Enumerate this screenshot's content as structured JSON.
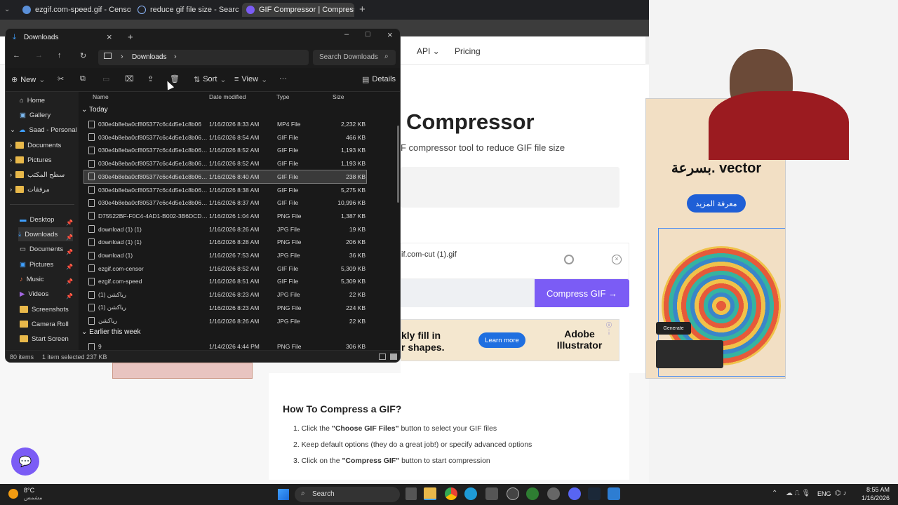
{
  "browser": {
    "tabs": [
      {
        "title": "ezgif.com-speed.gif - Censor a GI",
        "icon": "ezgif-icon"
      },
      {
        "title": "reduce gif file size - Search",
        "icon": "search-icon"
      },
      {
        "title": "GIF Compressor | Compress GIF A",
        "icon": "compressor-icon"
      }
    ],
    "new_tab": "+"
  },
  "site": {
    "nav": {
      "api": "API ⌄",
      "pricing": "Pricing"
    },
    "hero_title": "Compressor",
    "hero_subtitle": "F compressor tool to reduce GIF file size",
    "file_name": "if.com-cut (1).gif",
    "compress_button": "Compress GIF →",
    "ad": {
      "text_line1": "kly fill in",
      "text_line2": "r shapes.",
      "cta": "Learn more",
      "brand_line1": "Adobe",
      "brand_line2": "Illustrator"
    },
    "howto": {
      "title": "How To Compress a GIF?",
      "steps": [
        {
          "pre": "1. Click the ",
          "bold": "\"Choose GIF Files\"",
          "post": " button to select your GIF files"
        },
        {
          "pre": "2. Keep default options (they do a great job!) or specify advanced options",
          "bold": "",
          "post": ""
        },
        {
          "pre": "3. Click on the ",
          "bold": "\"Compress GIF\"",
          "post": " button to start compression"
        }
      ]
    },
    "side_ad": {
      "heading_ar": "بسرعة. vector",
      "cta_ar": "معرفة المزيد",
      "generate": "Generate"
    }
  },
  "explorer": {
    "title": "Downloads",
    "breadcrumb": "Downloads",
    "search_placeholder": "Search Downloads",
    "toolbar": {
      "new": "New",
      "sort": "Sort",
      "view": "View",
      "more": "···",
      "details": "Details"
    },
    "columns": {
      "name": "Name",
      "date": "Date modified",
      "type": "Type",
      "size": "Size"
    },
    "sidebar": [
      {
        "label": "Home",
        "icon": "home-icon"
      },
      {
        "label": "Gallery",
        "icon": "gallery-icon"
      },
      {
        "label": "Saad - Personal",
        "icon": "cloud-icon"
      },
      {
        "label": "Documents",
        "icon": "folder-icon"
      },
      {
        "label": "Pictures",
        "icon": "folder-icon"
      },
      {
        "label": "سطح المكتب",
        "icon": "folder-icon"
      },
      {
        "label": "مرفقات",
        "icon": "folder-icon"
      },
      {
        "label": "Desktop",
        "icon": "desktop-icon"
      },
      {
        "label": "Downloads",
        "icon": "download-icon"
      },
      {
        "label": "Documents",
        "icon": "documents-icon"
      },
      {
        "label": "Pictures",
        "icon": "pictures-icon"
      },
      {
        "label": "Music",
        "icon": "music-icon"
      },
      {
        "label": "Videos",
        "icon": "videos-icon"
      },
      {
        "label": "Screenshots",
        "icon": "folder-icon"
      },
      {
        "label": "Camera Roll",
        "icon": "folder-icon"
      },
      {
        "label": "Start Screen",
        "icon": "folder-icon"
      }
    ],
    "group_today": "Today",
    "group_earlier": "Earlier this week",
    "files": [
      {
        "name": "030e4b8eba0cf805377c6c4d5e1c8b06",
        "date": "1/16/2026 8:33 AM",
        "type": "MP4 File",
        "size": "2,232 KB"
      },
      {
        "name": "030e4b8eba0cf805377c6c4d5e1c8b06-ezg...",
        "date": "1/16/2026 8:54 AM",
        "type": "GIF File",
        "size": "466 KB"
      },
      {
        "name": "030e4b8eba0cf805377c6c4d5e1c8b06-ezg...",
        "date": "1/16/2026 8:52 AM",
        "type": "GIF File",
        "size": "1,193 KB"
      },
      {
        "name": "030e4b8eba0cf805377c6c4d5e1c8b06-ezg...",
        "date": "1/16/2026 8:52 AM",
        "type": "GIF File",
        "size": "1,193 KB"
      },
      {
        "name": "030e4b8eba0cf805377c6c4d5e1c8b06-ezg...",
        "date": "1/16/2026 8:40 AM",
        "type": "GIF File",
        "size": "238 KB",
        "selected": true
      },
      {
        "name": "030e4b8eba0cf805377c6c4d5e1c8b06-ezg...",
        "date": "1/16/2026 8:38 AM",
        "type": "GIF File",
        "size": "5,275 KB"
      },
      {
        "name": "030e4b8eba0cf805377c6c4d5e1c8b06-ezg...",
        "date": "1/16/2026 8:37 AM",
        "type": "GIF File",
        "size": "10,996 KB"
      },
      {
        "name": "D75522BF-F0C4-4AD1-B002-3B6DCDE78...",
        "date": "1/16/2026 1:04 AM",
        "type": "PNG File",
        "size": "1,387 KB"
      },
      {
        "name": "download (1) (1)",
        "date": "1/16/2026 8:26 AM",
        "type": "JPG File",
        "size": "19 KB"
      },
      {
        "name": "download (1) (1)",
        "date": "1/16/2026 8:28 AM",
        "type": "PNG File",
        "size": "206 KB"
      },
      {
        "name": "download (1)",
        "date": "1/16/2026 7:53 AM",
        "type": "JPG File",
        "size": "36 KB"
      },
      {
        "name": "ezgif.com-censor",
        "date": "1/16/2026 8:52 AM",
        "type": "GIF File",
        "size": "5,309 KB"
      },
      {
        "name": "ezgif.com-speed",
        "date": "1/16/2026 8:51 AM",
        "type": "GIF File",
        "size": "5,309 KB"
      },
      {
        "name": "رياكشن (1)",
        "date": "1/16/2026 8:23 AM",
        "type": "JPG File",
        "size": "22 KB"
      },
      {
        "name": "رياكشن (1)",
        "date": "1/16/2026 8:23 AM",
        "type": "PNG File",
        "size": "224 KB"
      },
      {
        "name": "رياكشن",
        "date": "1/16/2026 8:26 AM",
        "type": "JPG File",
        "size": "22 KB"
      }
    ],
    "earlier_files": [
      {
        "name": "9",
        "date": "1/14/2026 4:44 PM",
        "type": "PNG File",
        "size": "306 KB"
      }
    ],
    "status": {
      "items": "80 items",
      "selected": "1 item selected  237 KB"
    }
  },
  "taskbar": {
    "weather_temp": "8°C",
    "weather_desc": "مشمس",
    "search": "Search",
    "lang": "ENG",
    "time": "8:55 AM",
    "date": "1/16/2026"
  },
  "colors": {
    "accent": "#7b5cf5",
    "explorer_bg": "#202020",
    "folder": "#e8b84a"
  }
}
